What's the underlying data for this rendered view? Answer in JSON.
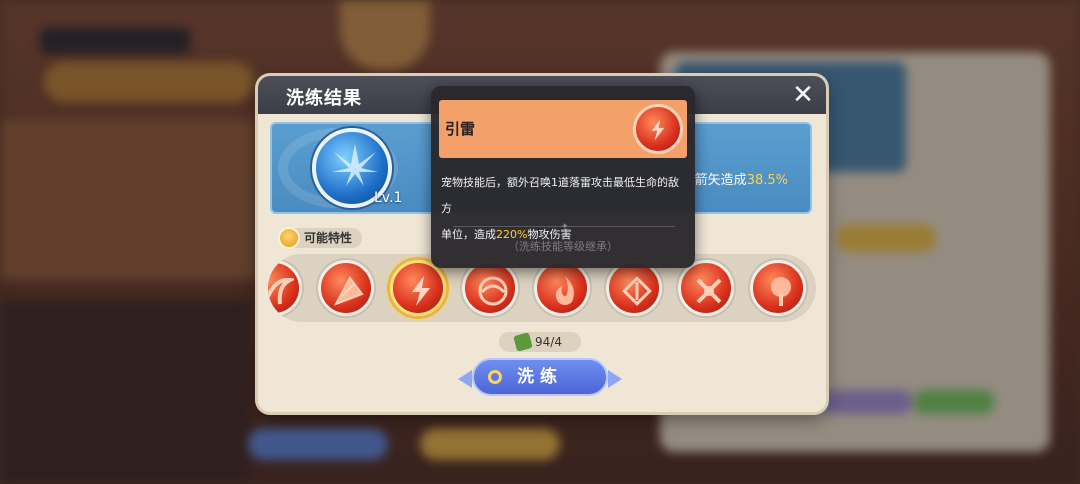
{
  "dialog": {
    "title": "洗练结果",
    "result": {
      "level_label": "Lv.1",
      "text_fragment": "箭矢造成",
      "value": "38.5%"
    },
    "traits_label": "可能特性",
    "traits": [
      {
        "icon": "swirl-trait-icon"
      },
      {
        "icon": "leaf-trait-icon"
      },
      {
        "icon": "lightning-trait-icon",
        "selected": true
      },
      {
        "icon": "wave-trait-icon"
      },
      {
        "icon": "flame-trait-icon"
      },
      {
        "icon": "rune-trait-icon"
      },
      {
        "icon": "cross-trait-icon"
      },
      {
        "icon": "tree-trait-icon"
      }
    ],
    "cost": "94/4",
    "refine_button": "洗练"
  },
  "tooltip": {
    "name": "引雷",
    "desc_line1": "宠物技能后，额外召唤1道落雷攻击最低生命的敌方",
    "desc_line2_pre": "单位，造成",
    "desc_value": "220%",
    "desc_line2_post": "物攻伤害",
    "note": "（洗练技能等级继承）"
  },
  "colors": {
    "title_bar": "#3b3e47",
    "result_panel": "#4a8bc0",
    "highlight": "#ffd24a",
    "tooltip_header": "#f4a06a",
    "button": "#4d66d6"
  }
}
